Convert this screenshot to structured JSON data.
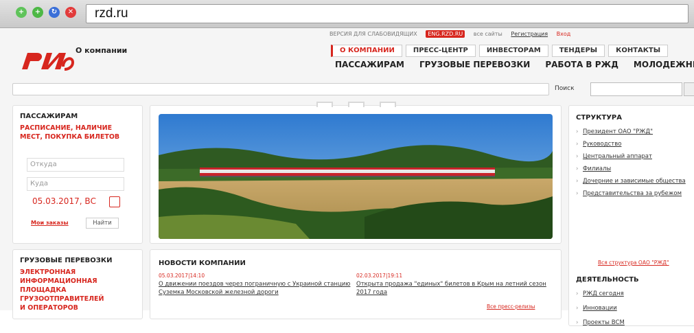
{
  "browser": {
    "url": "rzd.ru",
    "traffic_lights": [
      "icon-green",
      "icon-green",
      "icon-blue",
      "icon-red"
    ]
  },
  "header": {
    "topline": {
      "accessibility": "ВЕРСИЯ ДЛЯ СЛАБОВИДЯЩИХ",
      "eng": "ENG.RZD.RU",
      "all_sites": "все сайты",
      "register": "Регистрация",
      "login": "Вход"
    },
    "logo_text": "О компании",
    "menu_top": [
      "О КОМПАНИИ",
      "ПРЕСС-ЦЕНТР",
      "ИНВЕСТОРАМ",
      "ТЕНДЕРЫ",
      "КОНТАКТЫ"
    ],
    "menu_main": [
      "ПАССАЖИРАМ",
      "ГРУЗОВЫЕ ПЕРЕВОЗКИ",
      "РАБОТА В РЖД",
      "МОЛОДЕЖНЫЙ"
    ]
  },
  "search": {
    "label": "Поиск",
    "placeholder": ""
  },
  "passengers": {
    "title": "ПАССАЖИРАМ",
    "link_line1": "РАСПИСАНИЕ, НАЛИЧИЕ",
    "link_line2": "МЕСТ, ПОКУПКА БИЛЕТОВ",
    "from_placeholder": "Откуда",
    "to_placeholder": "Куда",
    "date": "05.03.2017, ВС",
    "my_orders": "Мои заказы",
    "find": "Найти"
  },
  "cargo": {
    "title": "ГРУЗОВЫЕ ПЕРЕВОЗКИ",
    "link": [
      "ЭЛЕКТРОННАЯ",
      "ИНФОРМАЦИОННАЯ",
      "ПЛОЩАДКА",
      "ГРУЗООТПРАВИТЕЛЕЙ",
      "И ОПЕРАТОРОВ"
    ]
  },
  "news": {
    "title": "НОВОСТИ КОМПАНИИ",
    "items": [
      {
        "date": "05.03.2017",
        "time": "14:10",
        "text": "О движении поездов через пограничную с Украиной станцию Суземка Московской железной дороги"
      },
      {
        "date": "02.03.2017",
        "time": "19:11",
        "text": "Открыта продажа \"единых\" билетов в Крым на летний сезон 2017 года"
      }
    ],
    "all_link": "Все пресс-релизы"
  },
  "structure": {
    "title": "СТРУКТУРА",
    "items": [
      "Президент ОАО \"РЖД\"",
      "Руководство",
      "Центральный аппарат",
      "Филиалы",
      "Дочерние и зависимые общества",
      "Представительства за рубежом"
    ],
    "all_link": "Вся структура ОАО \"РЖД\""
  },
  "activity": {
    "title": "ДЕЯТЕЛЬНОСТЬ",
    "items": [
      "РЖД сегодня",
      "Инновации",
      "Проекты ВСМ"
    ]
  },
  "colors": {
    "brand_red": "#d7261e",
    "text_dark": "#222222"
  }
}
